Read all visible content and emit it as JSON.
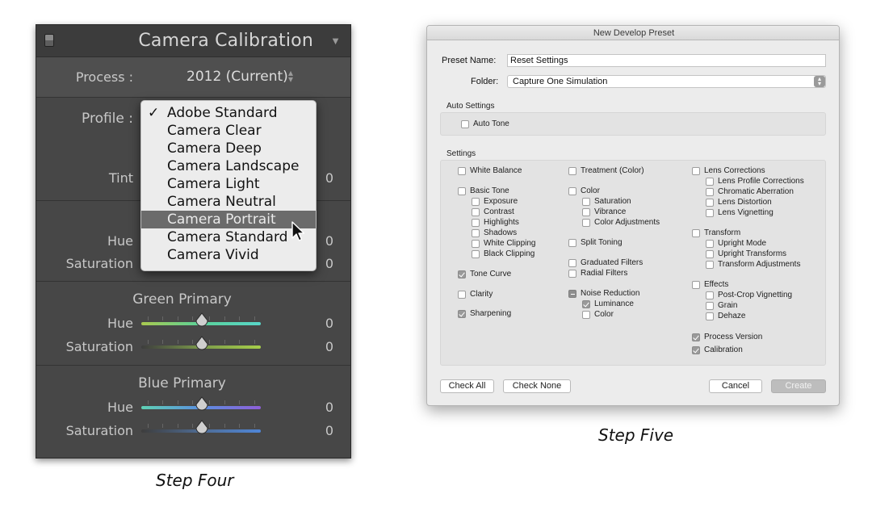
{
  "lightroom": {
    "panel_title": "Camera Calibration",
    "process": {
      "label": "Process :",
      "value": "2012 (Current)"
    },
    "profile": {
      "label": "Profile :",
      "options": [
        "Adobe Standard",
        "Camera Clear",
        "Camera Deep",
        "Camera Landscape",
        "Camera Light",
        "Camera Neutral",
        "Camera Portrait",
        "Camera Standard",
        "Camera Vivid"
      ],
      "checked": "Adobe Standard",
      "highlighted": "Camera Portrait"
    },
    "tint": {
      "label": "Tint",
      "value": "0"
    },
    "red_primary": {
      "hue_label": "Hue",
      "hue_value": "0",
      "sat_label": "Saturation",
      "sat_value": "0"
    },
    "green_primary": {
      "title": "Green Primary",
      "hue_label": "Hue",
      "hue_value": "0",
      "sat_label": "Saturation",
      "sat_value": "0"
    },
    "blue_primary": {
      "title": "Blue Primary",
      "hue_label": "Hue",
      "hue_value": "0",
      "sat_label": "Saturation",
      "sat_value": "0"
    },
    "caption": "Step Four"
  },
  "dialog": {
    "window_title": "New Develop Preset",
    "preset_name": {
      "label": "Preset Name:",
      "value": "Reset Settings"
    },
    "folder": {
      "label": "Folder:",
      "value": "Capture One Simulation"
    },
    "auto_settings": {
      "title": "Auto Settings",
      "auto_tone": "Auto Tone"
    },
    "settings_title": "Settings",
    "col1": {
      "white_balance": "White Balance",
      "basic_tone": "Basic Tone",
      "exposure": "Exposure",
      "contrast": "Contrast",
      "highlights": "Highlights",
      "shadows": "Shadows",
      "white_clipping": "White Clipping",
      "black_clipping": "Black Clipping",
      "tone_curve": "Tone Curve",
      "clarity": "Clarity",
      "sharpening": "Sharpening"
    },
    "col2": {
      "treatment": "Treatment (Color)",
      "color": "Color",
      "saturation": "Saturation",
      "vibrance": "Vibrance",
      "color_adjustments": "Color Adjustments",
      "split_toning": "Split Toning",
      "graduated_filters": "Graduated Filters",
      "radial_filters": "Radial Filters",
      "noise_reduction": "Noise Reduction",
      "luminance": "Luminance",
      "nr_color": "Color"
    },
    "col3": {
      "lens_corrections": "Lens Corrections",
      "lens_profile": "Lens Profile Corrections",
      "chromatic": "Chromatic Aberration",
      "lens_distortion": "Lens Distortion",
      "lens_vignetting": "Lens Vignetting",
      "transform": "Transform",
      "upright_mode": "Upright Mode",
      "upright_transforms": "Upright Transforms",
      "transform_adjustments": "Transform Adjustments",
      "effects": "Effects",
      "post_crop": "Post-Crop Vignetting",
      "grain": "Grain",
      "dehaze": "Dehaze",
      "process_version": "Process Version",
      "calibration": "Calibration"
    },
    "buttons": {
      "check_all": "Check All",
      "check_none": "Check None",
      "cancel": "Cancel",
      "create": "Create"
    },
    "caption": "Step Five"
  }
}
